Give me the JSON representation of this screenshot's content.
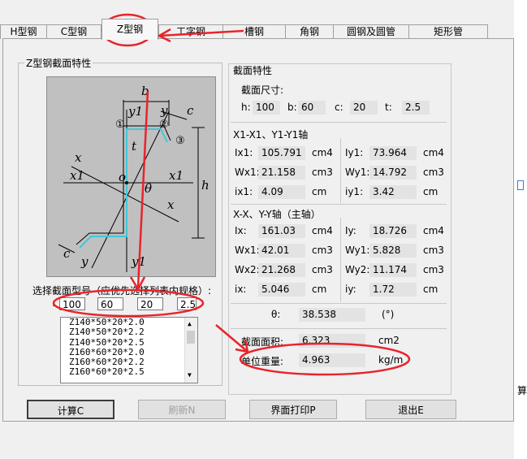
{
  "tabs": [
    "H型钢",
    "C型钢",
    "Z型钢",
    "工字钢",
    "槽钢",
    "角钢",
    "圆钢及圆管",
    "矩形管"
  ],
  "active_tab": "Z型钢",
  "left_group": {
    "title": "Z型钢截面特性",
    "select_label": "选择截面型号（应优先选择列表内规格）:",
    "dims_prefix": ":",
    "dims": [
      "100",
      "60",
      "20",
      "2.5"
    ],
    "list_items": [
      "Z140*50*20*2.0",
      "Z140*50*20*2.2",
      "Z140*50*20*2.5",
      "Z160*60*20*2.0",
      "Z160*60*20*2.2",
      "Z160*60*20*2.5"
    ]
  },
  "drawing_labels": {
    "b": "b",
    "y1_top": "y1",
    "y_top": "y",
    "c_top": "c",
    "n1": "①",
    "n2": "②",
    "n3": "③",
    "t": "t",
    "x_left": "x",
    "x1_left": "x1",
    "o": "o",
    "theta": "θ",
    "x1_right": "x1",
    "x_right": "x",
    "h": "h",
    "c_bottom": "c",
    "y_bottom": "y",
    "y1_bottom": "y1"
  },
  "right_group": {
    "title": "截面特性",
    "dims_title": "截面尺寸:",
    "dims": [
      {
        "label": "h:",
        "value": "100"
      },
      {
        "label": "b:",
        "value": "60"
      },
      {
        "label": "c:",
        "value": "20"
      },
      {
        "label": "t:",
        "value": "2.5"
      }
    ],
    "axis1_title": "X1-X1、Y1-Y1轴",
    "axis1_left": [
      {
        "label": "Ix1:",
        "value": "105.791",
        "unit": "cm4"
      },
      {
        "label": "Wx1:",
        "value": "21.158",
        "unit": "cm3"
      },
      {
        "label": "ix1:",
        "value": "4.09",
        "unit": "cm"
      }
    ],
    "axis1_right": [
      {
        "label": "Iy1:",
        "value": "73.964",
        "unit": "cm4"
      },
      {
        "label": "Wy1:",
        "value": "14.792",
        "unit": "cm3"
      },
      {
        "label": "iy1:",
        "value": "3.42",
        "unit": "cm"
      }
    ],
    "axis2_title": "X-X、Y-Y轴（主轴）",
    "axis2_left": [
      {
        "label": "Ix:",
        "value": "161.03",
        "unit": "cm4"
      },
      {
        "label": "Wx1:",
        "value": "42.01",
        "unit": "cm3"
      },
      {
        "label": "Wx2:",
        "value": "21.268",
        "unit": "cm3"
      },
      {
        "label": "ix:",
        "value": "5.046",
        "unit": "cm"
      }
    ],
    "axis2_right": [
      {
        "label": "Iy:",
        "value": "18.726",
        "unit": "cm4"
      },
      {
        "label": "Wy1:",
        "value": "5.828",
        "unit": "cm3"
      },
      {
        "label": "Wy2:",
        "value": "11.174",
        "unit": "cm3"
      },
      {
        "label": "iy:",
        "value": "1.72",
        "unit": "cm"
      }
    ],
    "theta_label": "θ:",
    "theta_value": "38.538",
    "theta_unit": "(°)",
    "area_label": "截面面积:",
    "area_value": "6.323",
    "area_unit": "cm2",
    "weight_label": "单位重量:",
    "weight_value": "4.963",
    "weight_unit": "kg/m"
  },
  "buttons": {
    "calc": "计算C",
    "refresh": "刷新N",
    "print": "界面打印P",
    "exit": "退出E"
  },
  "side_text": "算",
  "colors": {
    "annotation_red": "#e8242b",
    "section_cyan": "#40c8d8"
  }
}
